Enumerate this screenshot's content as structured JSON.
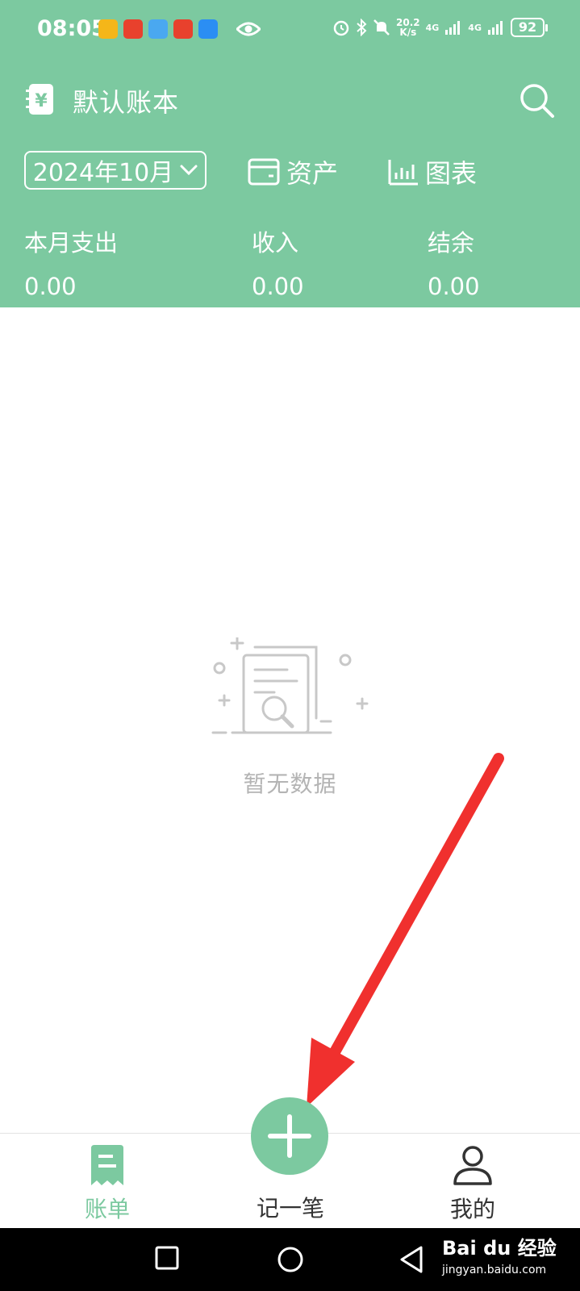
{
  "status_bar": {
    "time": "08:05",
    "speed_top": "20.2",
    "speed_bottom": "K/s",
    "net1": "4G",
    "net2": "4G",
    "battery": "92"
  },
  "header": {
    "book_title": "默认账本",
    "month": "2024年10月",
    "assets_label": "资产",
    "chart_label": "图表",
    "brand_color": "#7cc9a0"
  },
  "summary": {
    "expense_label": "本月支出",
    "expense_value": "0.00",
    "income_label": "收入",
    "income_value": "0.00",
    "balance_label": "结余",
    "balance_value": "0.00"
  },
  "empty_state": {
    "text": "暂无数据"
  },
  "bottom_nav": {
    "bill_label": "账单",
    "add_label": "记一笔",
    "mine_label": "我的"
  },
  "watermark": {
    "brand": "Bai du 经验",
    "url": "jingyan.baidu.com"
  },
  "icons": {
    "book": "yen-book-icon",
    "search": "search-icon",
    "wallet": "wallet-icon",
    "chart": "bar-chart-icon",
    "bill": "receipt-icon",
    "add": "plus-icon",
    "user": "user-icon"
  }
}
